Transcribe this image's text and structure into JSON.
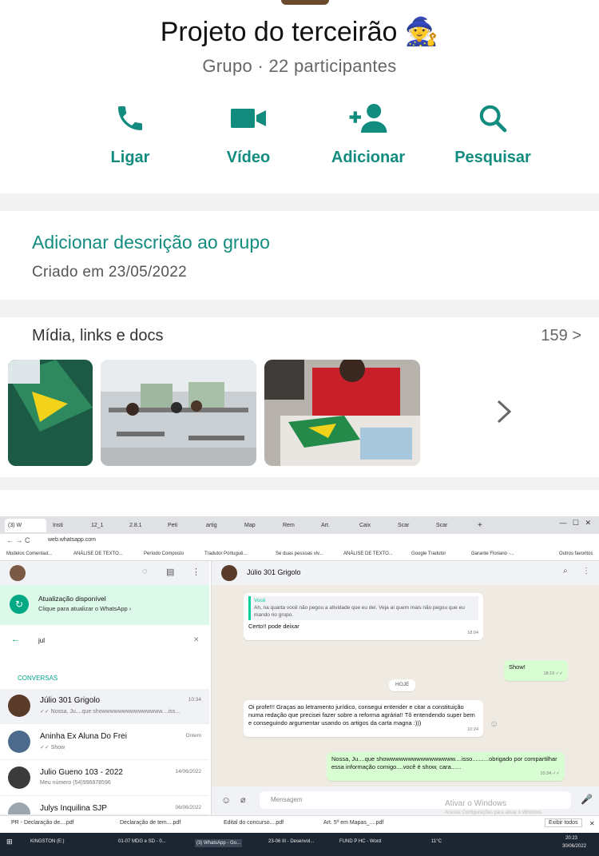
{
  "group": {
    "title": "Projeto do terceirão 🧙",
    "subtitle": "Grupo · 22 participantes"
  },
  "actions": [
    {
      "label": "Ligar",
      "icon": "phone-icon"
    },
    {
      "label": "Vídeo",
      "icon": "video-icon"
    },
    {
      "label": "Adicionar",
      "icon": "add-person-icon"
    },
    {
      "label": "Pesquisar",
      "icon": "search-icon"
    }
  ],
  "description": {
    "title": "Adicionar descrição ao grupo",
    "created": "Criado em 23/05/2022"
  },
  "media": {
    "title": "Mídia, links e docs",
    "count": "159 >"
  },
  "colors": {
    "accent": "#128c7e",
    "wa_green": "#00a884"
  },
  "browser": {
    "tabs": [
      "(3) W",
      "Insti",
      "12_1",
      "2.8.1",
      "Peti",
      "artig",
      "Map",
      "Rem",
      "Art.",
      "Caix",
      "Scar",
      "Scar",
      "+"
    ],
    "url": "web.whatsapp.com",
    "bookmarks": [
      "Modelos Comentad...",
      "ANÁLISE DE TEXTO...",
      "Período Composto",
      "Tradutor Portuguê...",
      "Se duas pessoas viv...",
      "ANÁLISE DE TEXTO...",
      "Google Tradutor",
      "Garante Floriano -...",
      "Outros favoritos"
    ]
  },
  "whatsapp": {
    "update_title": "Atualização disponível",
    "update_sub": "Clique para atualizar o WhatsApp ›",
    "search_value": "jul",
    "conversations_label": "CONVERSAS",
    "chats": [
      {
        "name": "Júlio 301 Grigolo",
        "preview": "✓✓ Nossa, Ju....que showwwwwwwwwwwwwww....iss...",
        "time": "10:34"
      },
      {
        "name": "Aninha Ex Aluna Do Frei",
        "preview": "✓✓ Show",
        "time": "Ontem"
      },
      {
        "name": "Julio Gueno 103 - 2022",
        "preview": "Meu número (54)996878596",
        "time": "14/06/2022"
      },
      {
        "name": "Julys Inquilina SJP",
        "preview": "",
        "time": "06/06/2022"
      }
    ],
    "contact": "Júlio 301 Grigolo",
    "messages": [
      {
        "quote_author": "Você",
        "quote": "Ah, na quarta você não pegou a atividade que eu dei. Veja aí quem mais não pegou que eu mando no grupo.",
        "text": "Certo!! pode deixar",
        "time": "18:04"
      },
      {
        "text": "Show!",
        "time": "18:10 ✓✓"
      },
      {
        "text": "HOJE"
      },
      {
        "text": "Oi profe!!! Graças ao letramento jurídico, consegui entender e citar a constituição numa redação que precisei fazer sobre a reforma agrária!! Tô entendendo super bem e conseguindo argumentar usando os artigos da carta magna :)))",
        "time": "10:24"
      },
      {
        "text": "Nossa, Ju....que showwwwwwwwwwwwwwww....isso..........obrigado por compartilhar essa informação comigo....você é show, cara......",
        "time": "10:34 ✓✓"
      }
    ],
    "composer_placeholder": "Mensagem",
    "watermark_title": "Ativar o Windows",
    "watermark_sub": "Acesse Configurações para ativar o Windows."
  },
  "downloads": [
    "PR - Declaração de....pdf",
    "Declaração de tem....pdf",
    "Edital do concurso....pdf",
    "Art. 5º em Mapas_....pdf"
  ],
  "downloads_show_all": "Exibir todos",
  "taskbar": {
    "items": [
      "KINGSTON (E:)",
      "01-07 MDG e SD - 0...",
      "(3) WhatsApp - Go...",
      "23-06 III - Desenvol...",
      "FUND P HC - Word"
    ],
    "weather": "11°C",
    "time": "20:23",
    "date": "30/06/2022"
  }
}
